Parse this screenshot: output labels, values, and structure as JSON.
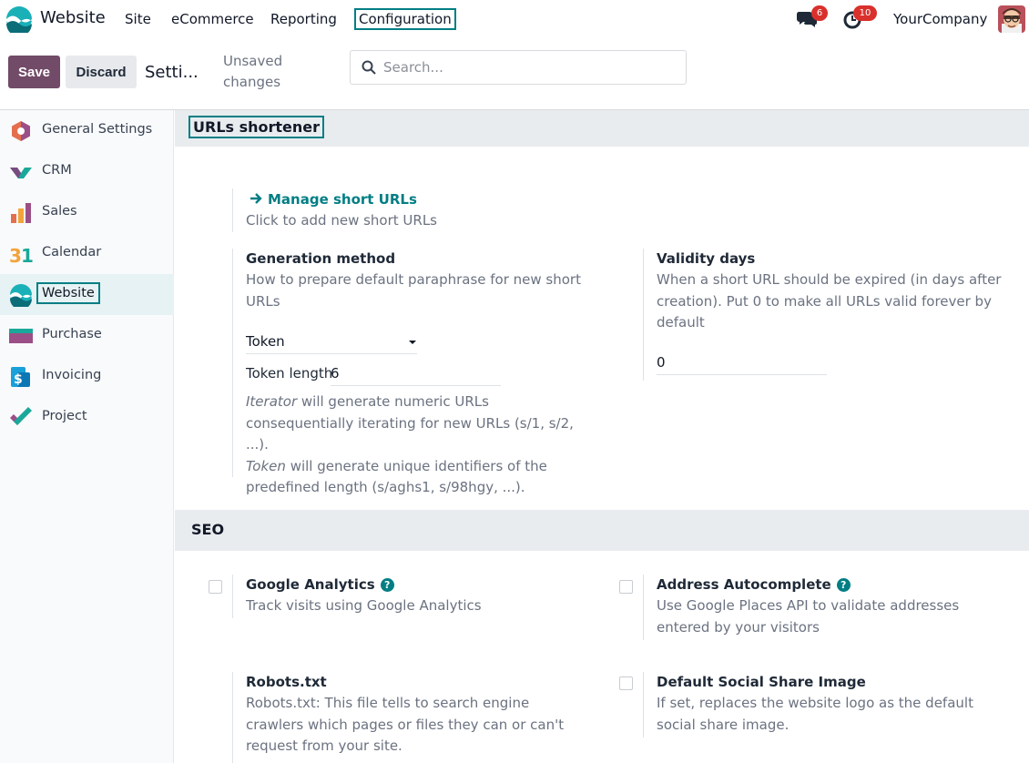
{
  "nav": {
    "app_name": "Website",
    "menu": [
      "Site",
      "eCommerce",
      "Reporting",
      "Configuration"
    ],
    "chat_count": "6",
    "activity_count": "10",
    "company": "YourCompany",
    "colors": {
      "accent": "#017e84",
      "brand": "#714b67",
      "badge": "#d9302c"
    }
  },
  "control": {
    "save": "Save",
    "discard": "Discard",
    "breadcrumb": "Setti...",
    "unsaved": "Unsaved changes",
    "search_placeholder": "Search..."
  },
  "sidebar": {
    "items": [
      {
        "label": "General Settings",
        "icon": "general-settings-icon"
      },
      {
        "label": "CRM",
        "icon": "crm-icon"
      },
      {
        "label": "Sales",
        "icon": "sales-icon"
      },
      {
        "label": "Calendar",
        "icon": "calendar-icon"
      },
      {
        "label": "Website",
        "icon": "website-icon",
        "active": true
      },
      {
        "label": "Purchase",
        "icon": "purchase-icon"
      },
      {
        "label": "Invoicing",
        "icon": "invoicing-icon"
      },
      {
        "label": "Project",
        "icon": "project-icon"
      }
    ]
  },
  "urls": {
    "section_title": "URLs shortener",
    "manage_link": "Manage short URLs",
    "manage_desc": "Click to add new short URLs",
    "gen_title": "Generation method",
    "gen_desc": "How to prepare default paraphrase for new short URLs",
    "gen_value": "Token",
    "token_length_label": "Token length",
    "token_length_value": "6",
    "iterator_word": "Iterator",
    "iterator_text": " will generate numeric URLs consequentially iterating for new URLs (s/1, s/2, ...).",
    "token_word": "Token",
    "token_text": " will generate unique identifiers of the predefined length (s/aghs1, s/98hgy, ...).",
    "validity_title": "Validity days",
    "validity_desc": "When a short URL should be expired (in days after creation). Put 0 to make all URLs valid forever by default",
    "validity_value": "0"
  },
  "seo": {
    "section_title": "SEO",
    "ga_title": "Google Analytics",
    "ga_desc": "Track visits using Google Analytics",
    "addr_title": "Address Autocomplete",
    "addr_desc": "Use Google Places API to validate addresses entered by your visitors",
    "robots_title": "Robots.txt",
    "robots_desc": "Robots.txt: This file tells to search engine crawlers which pages or files they can or can't request from your site.",
    "social_title": "Default Social Share Image",
    "social_desc": "If set, replaces the website logo as the default social share image."
  }
}
